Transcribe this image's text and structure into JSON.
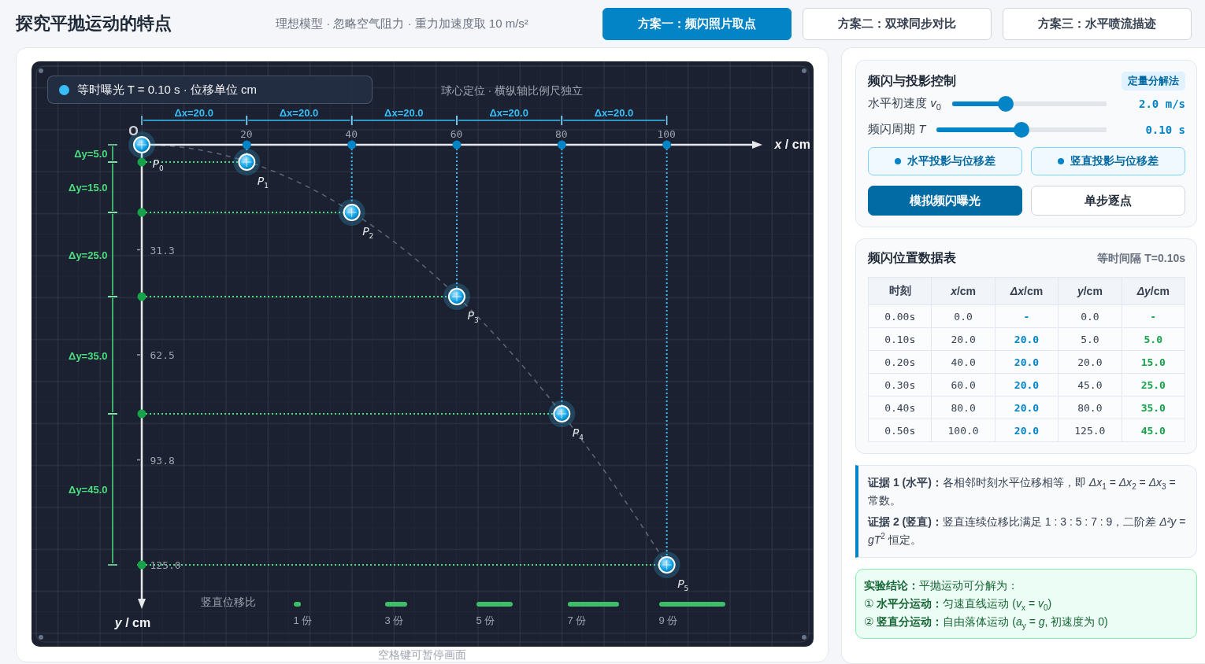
{
  "header": {
    "title": "探究平抛运动的特点",
    "subtitle": "理想模型 · 忽略空气阻力 · 重力加速度取 10 m/s²",
    "tabs": [
      {
        "label": "方案一：频闪照片取点",
        "selected": true
      },
      {
        "label": "方案二：双球同步对比",
        "selected": false
      },
      {
        "label": "方案三：水平喷流描迹",
        "selected": false
      }
    ]
  },
  "diagram": {
    "legend": "等时曝光 T = 0.10 s · 位移单位 cm",
    "caption": "球心定位 · 横纵轴比例尺独立",
    "origin_label": "O",
    "x_axis_label": "*x* / cm",
    "y_axis_label": "*y* / cm",
    "x_ticks": [
      "20",
      "40",
      "60",
      "80",
      "100"
    ],
    "y_ticks": [
      "31.3",
      "62.5",
      "93.8",
      "125.0"
    ],
    "dx_labels": [
      "Δx=20.0",
      "Δx=20.0",
      "Δx=20.0",
      "Δx=20.0",
      "Δx=20.0"
    ],
    "dy_labels": [
      "Δy=5.0",
      "Δy=15.0",
      "Δy=25.0",
      "Δy=35.0",
      "Δy=45.0"
    ],
    "points": [
      {
        "label": "*P*$_{0}$"
      },
      {
        "label": "*P*$_{1}$"
      },
      {
        "label": "*P*$_{2}$"
      },
      {
        "label": "*P*$_{3}$"
      },
      {
        "label": "*P*$_{4}$"
      },
      {
        "label": "*P*$_{5}$"
      }
    ],
    "ratio": {
      "title": "竖直位移比",
      "bars": [
        {
          "label": "1 份"
        },
        {
          "label": "3 份"
        },
        {
          "label": "5 份"
        },
        {
          "label": "7 份"
        },
        {
          "label": "9 份"
        }
      ]
    },
    "hint": "空格键可暂停画面"
  },
  "controls": {
    "title": "频闪与投影控制",
    "badge": "定量分解法",
    "sliders": [
      {
        "label": "水平初速度 *v*$_{0}$",
        "level": 0.35,
        "value": "2.0 m/s"
      },
      {
        "label": "频闪周期 *T*",
        "level": 0.5,
        "value": "0.10 s"
      }
    ],
    "toggles": [
      {
        "label": "水平投影与位移差",
        "on": true
      },
      {
        "label": "竖直投影与位移差",
        "on": true
      }
    ],
    "buttons": [
      {
        "label": "模拟频闪曝光",
        "kind": "primary"
      },
      {
        "label": "单步逐点",
        "kind": "secondary"
      }
    ]
  },
  "table": {
    "title": "频闪位置数据表",
    "note": "等时间隔 T=0.10s",
    "columns": [
      {
        "label": "时刻",
        "kind": "plain"
      },
      {
        "label": "*x*/cm",
        "kind": "plain"
      },
      {
        "label": "*Δx*/cm",
        "kind": "delta_x"
      },
      {
        "label": "*y*/cm",
        "kind": "plain"
      },
      {
        "label": "*Δy*/cm",
        "kind": "delta_y"
      }
    ],
    "rows": [
      [
        "0.00s",
        "0.0",
        "-",
        "0.0",
        "-"
      ],
      [
        "0.10s",
        "20.0",
        "20.0",
        "5.0",
        "5.0"
      ],
      [
        "0.20s",
        "40.0",
        "20.0",
        "20.0",
        "15.0"
      ],
      [
        "0.30s",
        "60.0",
        "20.0",
        "45.0",
        "25.0"
      ],
      [
        "0.40s",
        "80.0",
        "20.0",
        "80.0",
        "35.0"
      ],
      [
        "0.50s",
        "100.0",
        "20.0",
        "125.0",
        "45.0"
      ]
    ]
  },
  "evidence": [
    "**证据 1 (水平)：**各相邻时刻水平位移相等，即 *Δx*$_{1}$ = *Δx*$_{2}$ = *Δx*$_{3}$ = 常数。",
    "**证据 2 (竖直)：**竖直连续位移比满足 1 : 3 : 5 : 7 : 9，二阶差 *Δ²y* = *gT*$^{2}$ 恒定。"
  ],
  "conclusion": [
    "**实验结论：**平抛运动可分解为：",
    "① **水平分运动：**匀速直线运动 (*v*$_{x}$ = *v*$_{0}$)",
    "② **竖直分运动：**自由落体运动 (*a*$_{y}$ = *g*, 初速度为 0)"
  ]
}
